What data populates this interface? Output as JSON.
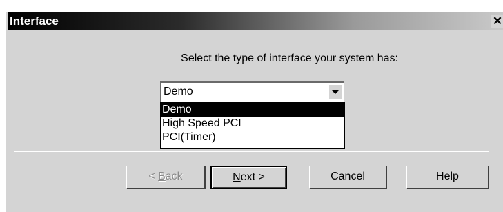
{
  "window": {
    "title": "Interface",
    "close_glyph": "✕"
  },
  "prompt": "Select the type of interface your system has:",
  "select": {
    "value": "Demo",
    "options": [
      "Demo",
      "High Speed PCI",
      "PCI(Timer)"
    ],
    "selected_index": 0
  },
  "buttons": {
    "back": {
      "pre": "< ",
      "mnemonic": "B",
      "post": "ack",
      "enabled": false
    },
    "next": {
      "mnemonic": "N",
      "post": "ext >",
      "enabled": true
    },
    "cancel": "Cancel",
    "help": "Help"
  },
  "colors": {
    "dialog_bg": "#d4d4d4",
    "selection_bg": "#000000",
    "selection_fg": "#ffffff"
  }
}
